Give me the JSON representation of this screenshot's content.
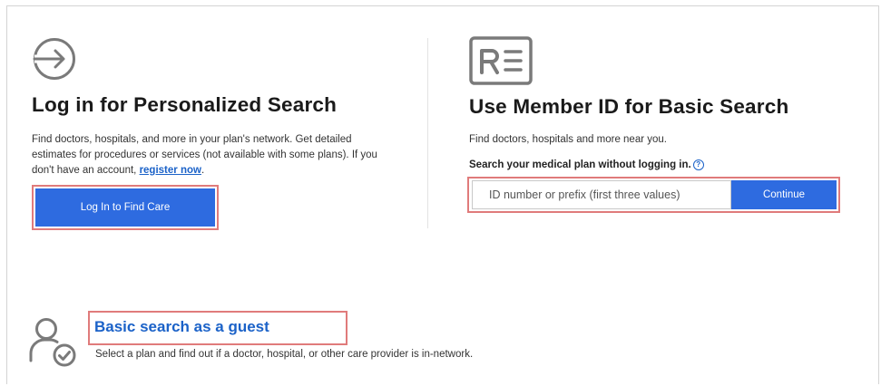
{
  "login": {
    "icon": "arrow-right-circle-icon",
    "title": "Log in for Personalized Search",
    "desc_before": "Find doctors, hospitals, and more in your plan's network. Get detailed estimates for procedures or services (not available with some plans). If you don't have an account, ",
    "register_link": "register now",
    "desc_after": ".",
    "button": "Log In to Find Care"
  },
  "member": {
    "icon": "id-card-icon",
    "title": "Use Member ID for Basic Search",
    "desc": "Find doctors, hospitals and more near you.",
    "search_label": "Search your medical plan without logging in.",
    "help_glyph": "?",
    "input_placeholder": "ID number or prefix (first three values)",
    "input_value": "",
    "continue_button": "Continue"
  },
  "guest": {
    "icon": "user-check-icon",
    "title": "Basic search as a guest",
    "desc": "Select a plan and find out if a doctor, hospital, or other care provider is in-network."
  },
  "colors": {
    "primary": "#2e6be0",
    "link": "#1b62c8",
    "highlight": "#e07b7b",
    "icon_gray": "#7a7a7a"
  }
}
